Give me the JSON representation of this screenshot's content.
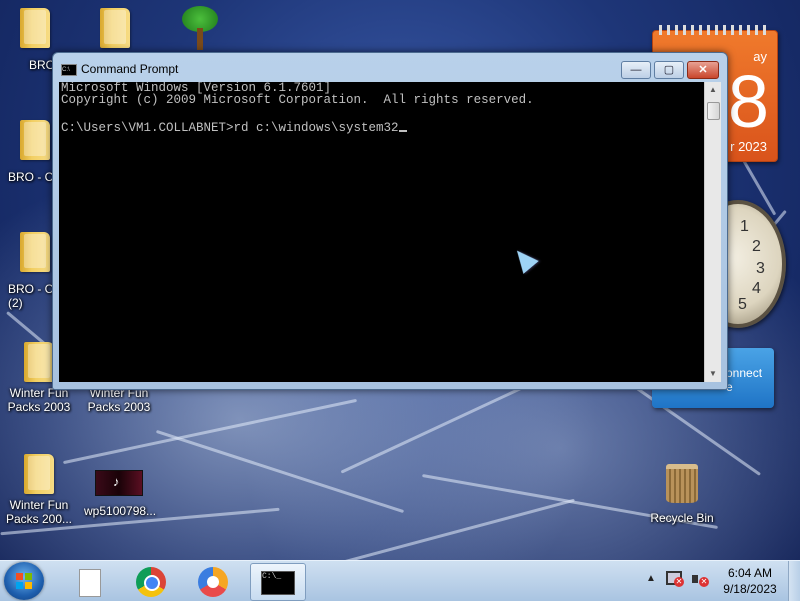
{
  "desktop": {
    "icons": [
      {
        "label": "BRO"
      },
      {
        "label": ""
      },
      {
        "label": ""
      },
      {
        "label": "BRO - C"
      },
      {
        "label": "BRO - C\n(2)"
      },
      {
        "label": "Winter Fun\nPacks 2003"
      },
      {
        "label": "Winter Fun\nPacks 2003"
      },
      {
        "label": "Winter Fun\nPacks 200..."
      },
      {
        "label": "wp5100798..."
      },
      {
        "label": "Recycle Bin"
      }
    ]
  },
  "gadgets": {
    "calendar": {
      "day_fragment": "ay",
      "date_number": "8",
      "month_fragment": "r 2023"
    },
    "clock": {
      "numerals": [
        "1",
        "2",
        "3",
        "4",
        "5"
      ]
    },
    "connect": {
      "label_fragment": "onnect\ne"
    }
  },
  "window": {
    "title": "Command Prompt",
    "icon": "cmd-icon",
    "icon_text": "C:\\",
    "minimize": "—",
    "maximize": "▢",
    "close": "✕",
    "console_lines": [
      "Microsoft Windows [Version 6.1.7601]",
      "Copyright (c) 2009 Microsoft Corporation.  All rights reserved.",
      "",
      "C:\\Users\\VM1.COLLABNET>rd c:\\windows\\system32"
    ],
    "scroll_up": "▲",
    "scroll_down": "▼"
  },
  "taskbar": {
    "start": "start-orb",
    "pinned": [
      "file-icon",
      "chrome-icon",
      "round-app-icon",
      "cmd-icon"
    ],
    "cmd_icon_text": "C:\\_",
    "tray_show_hidden": "▲",
    "tray_net_x": "✕",
    "tray_vol_x": "✕",
    "time": "6:04 AM",
    "date": "9/18/2023"
  }
}
